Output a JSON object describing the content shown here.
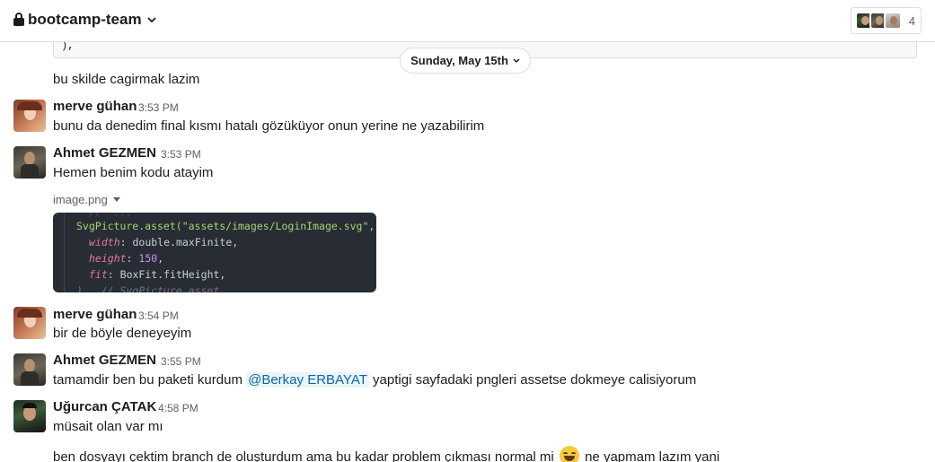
{
  "header": {
    "channel_name": "bootcamp-team",
    "member_count": "4"
  },
  "code_remnant": "),",
  "date_divider": "Sunday, May 15th",
  "messages": [
    {
      "text": "bu skilde cagirmak lazim"
    },
    {
      "sender": "merve gühan",
      "time": "3:53 PM",
      "text": "bunu da denedim final kısmı hatalı gözüküyor onun yerine ne yazabilirim"
    },
    {
      "sender": "Ahmet GEZMEN",
      "time": "3:53 PM",
      "text": "Hemen benim kodu atayim"
    },
    {
      "sender": "merve gühan",
      "time": "3:54 PM",
      "text": "bir de böyle deneyeyim"
    },
    {
      "sender": "Ahmet GEZMEN",
      "time": "3:55 PM",
      "text_before": "tamamdir ben bu paketi kurdum",
      "mention": "@Berkay ERBAYAT",
      "text_after": "yaptigi sayfadaki pngleri assetse dokmeye calisiyorum"
    },
    {
      "sender": "Uğurcan ÇATAK",
      "time": "4:58 PM",
      "text": "müsait olan var mı"
    },
    {
      "text_before": "ben dosyayı çektim branch de oluşturdum ama bu kadar problem çıkması normal mi",
      "text_after": "ne yapmam lazım yani",
      "emoji": "grinning-smile-emoji"
    }
  ],
  "attachment": {
    "file_name": "image.png",
    "code": {
      "line1": "SvgPicture.asset(\"assets/images/LoginImage.svg\",",
      "line2_prop": "width",
      "line2_val": "double.maxFinite,",
      "line3_prop": "height",
      "line3_val": "150",
      "line4_prop": "fit",
      "line4_val": "BoxFit.fitHeight,",
      "line5": "),  // SvgPicture.asset"
    }
  },
  "colors": {
    "mention_bg": "#e8f5fa",
    "mention_text": "#1264a3",
    "code_bg": "#282c34"
  }
}
